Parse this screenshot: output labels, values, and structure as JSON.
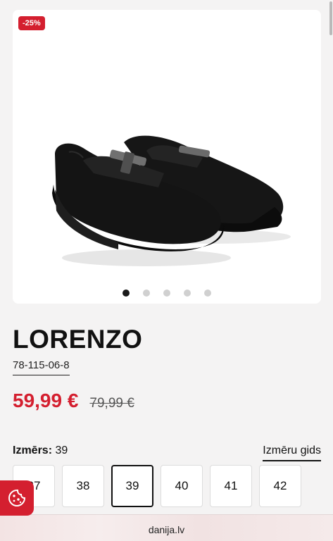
{
  "product": {
    "discount_badge": "-25%",
    "name": "LORENZO",
    "sku": "78-115-06-8",
    "price": "59,99 €",
    "old_price": "79,99 €",
    "image_icon": "black-loafer-shoes-photo"
  },
  "gallery": {
    "dot_count": 5,
    "active_index": 0
  },
  "size": {
    "label": "Izmērs:",
    "selected_value": "39",
    "guide_link": "Izmēru gids",
    "options": [
      "37",
      "38",
      "39",
      "40",
      "41",
      "42"
    ]
  },
  "cookie": {
    "icon": "cookie-icon"
  },
  "browser": {
    "url": "danija.lv"
  },
  "colors": {
    "accent": "#d41f2f",
    "background": "#f4f3f3",
    "card": "#ffffff"
  }
}
